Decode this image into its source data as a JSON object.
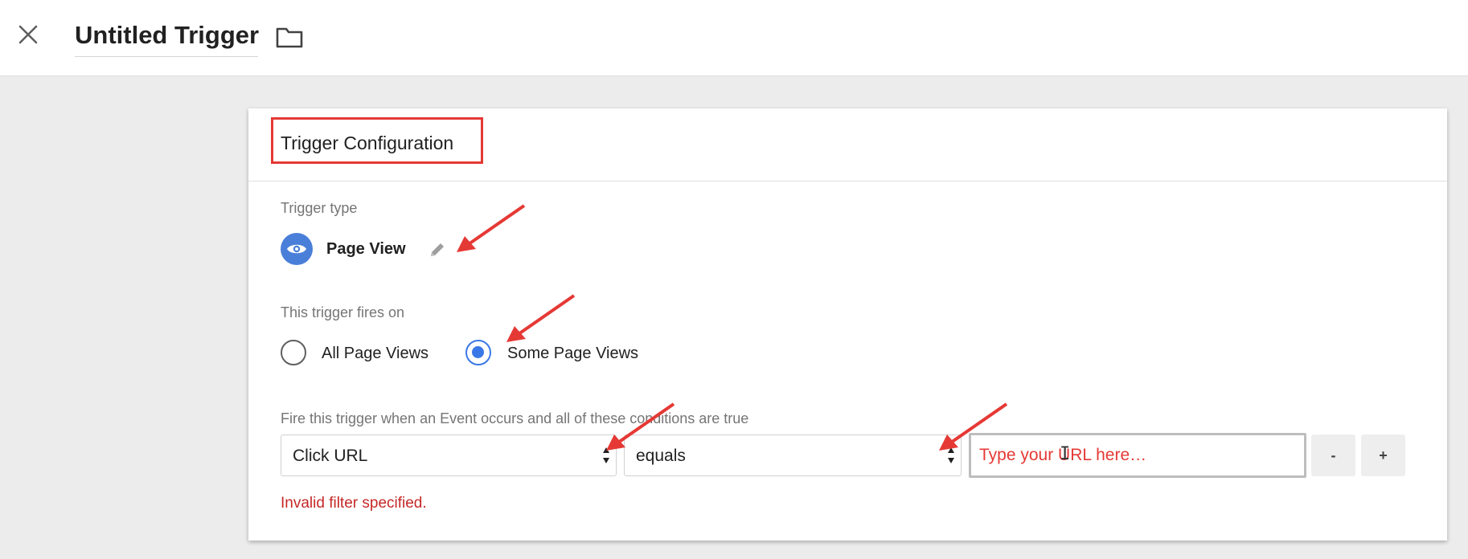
{
  "header": {
    "title": "Untitled Trigger",
    "close_icon": "close-icon",
    "folder_icon": "folder-icon"
  },
  "card": {
    "title": "Trigger Configuration",
    "trigger_type_label": "Trigger type",
    "trigger_type": {
      "name": "Page View",
      "icon": "eye-icon",
      "edit_icon": "pencil-icon"
    },
    "fires_on_label": "This trigger fires on",
    "fires_on_options": [
      {
        "label": "All Page Views",
        "selected": false
      },
      {
        "label": "Some Page Views",
        "selected": true
      }
    ],
    "condition_label": "Fire this trigger when an Event occurs and all of these conditions are true",
    "condition": {
      "variable": "Click URL",
      "operator": "equals",
      "value_placeholder": "Type your URL here…",
      "value": ""
    },
    "remove_label": "-",
    "add_label": "+",
    "error": "Invalid filter specified."
  },
  "colors": {
    "accent": "#4a7fd9",
    "radio_selected": "#3b78e7",
    "annotation": "#e53935",
    "error": "#c62828"
  }
}
